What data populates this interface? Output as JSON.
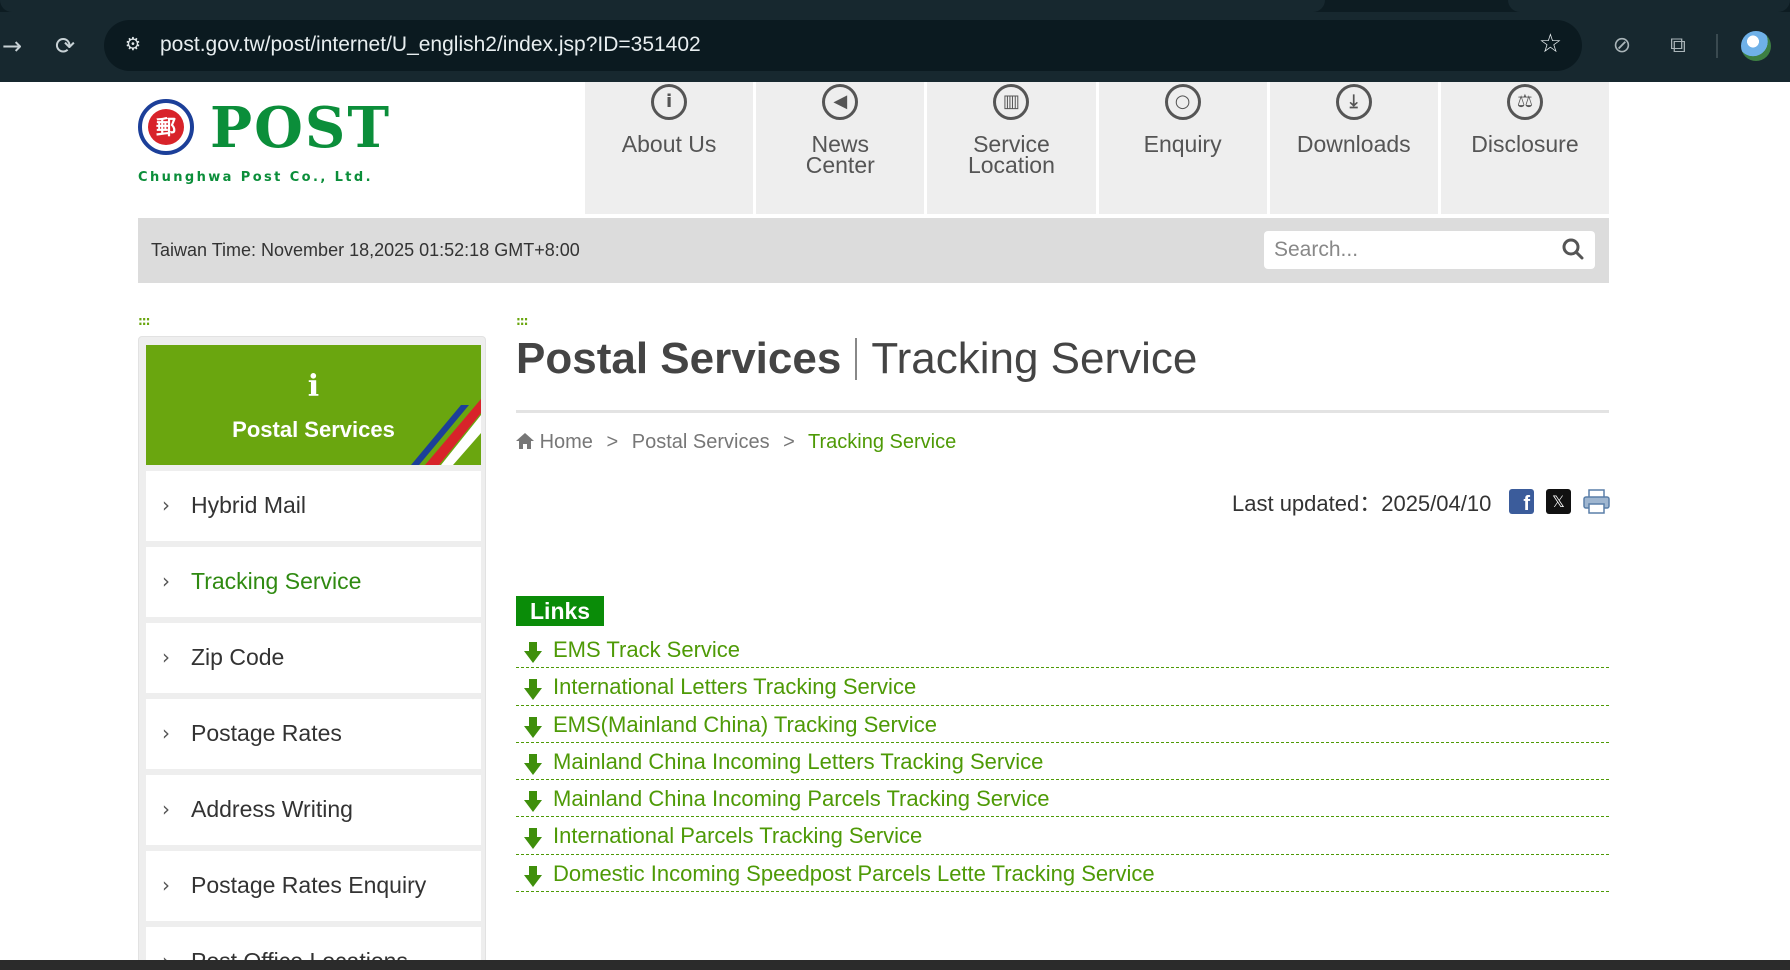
{
  "browser": {
    "url": "post.gov.tw/post/internet/U_english2/index.jsp?ID=351402"
  },
  "header": {
    "logo_word": "POST",
    "logo_seal": "郵",
    "logo_subtitle": "Chunghwa Post Co., Ltd.",
    "nav": [
      {
        "label": "About Us",
        "icon": "info-icon",
        "glyph": "i"
      },
      {
        "label": "News\nCenter",
        "icon": "megaphone-icon",
        "glyph": "◀"
      },
      {
        "label": "Service\nLocation",
        "icon": "building-icon",
        "glyph": "▥"
      },
      {
        "label": "Enquiry",
        "icon": "magnifier-icon",
        "glyph": "○"
      },
      {
        "label": "Downloads",
        "icon": "download-icon",
        "glyph": "⤓"
      },
      {
        "label": "Disclosure",
        "icon": "gavel-icon",
        "glyph": "⚖"
      }
    ]
  },
  "timebar": {
    "time_text": "Taiwan Time: November 18,2025 01:52:18 GMT+8:00",
    "search_placeholder": "Search..."
  },
  "decor": {
    "dots": ":::"
  },
  "sidebar": {
    "head_icon": "i",
    "title": "Postal Services",
    "chevron": "›",
    "items": [
      {
        "label": "Hybrid Mail",
        "active": false
      },
      {
        "label": "Tracking Service",
        "active": true
      },
      {
        "label": "Zip Code",
        "active": false
      },
      {
        "label": "Postage Rates",
        "active": false
      },
      {
        "label": "Address Writing",
        "active": false
      },
      {
        "label": "Postage Rates Enquiry",
        "active": false
      },
      {
        "label": "Post Office Locations",
        "active": false
      }
    ]
  },
  "content": {
    "title_main": "Postal Services",
    "title_sub": "Tracking Service",
    "breadcrumb": {
      "home": "Home",
      "sep": ">",
      "level1": "Postal Services",
      "current": "Tracking Service"
    },
    "last_updated": "Last updated：2025/04/10",
    "share": {
      "facebook": "f",
      "x": "𝕏"
    },
    "links_heading": "Links",
    "links": [
      "EMS Track Service",
      "International Letters Tracking Service",
      "EMS(Mainland China) Tracking Service",
      "Mainland China Incoming Letters Tracking Service",
      "Mainland China Incoming Parcels Tracking Service",
      "International Parcels Tracking Service",
      "Domestic Incoming Speedpost Parcels Lette Tracking Service"
    ]
  },
  "colors": {
    "brand_green": "#0b8e3a",
    "accent_green": "#6aa60f",
    "link_green": "#4e9a06",
    "links_heading_bg": "#0a8c08",
    "chrome_bg": "#17282f"
  }
}
